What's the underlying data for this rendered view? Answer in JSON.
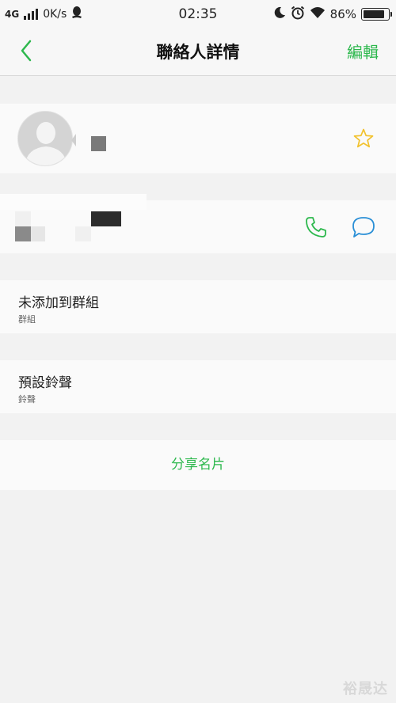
{
  "status_bar": {
    "network": "4G",
    "speed": "0K/s",
    "time": "02:35",
    "battery": "86%",
    "battery_level": 0.86,
    "icons": [
      "signal-icon",
      "qq-icon",
      "moon-icon",
      "alarm-icon",
      "wifi-icon",
      "battery-icon"
    ]
  },
  "nav": {
    "back_icon": "chevron-left-icon",
    "title": "聯絡人詳情",
    "edit_label": "編輯"
  },
  "contact": {
    "avatar_icon": "person-silhouette-icon",
    "favorite_icon": "star-icon"
  },
  "phone": {
    "call_icon": "phone-icon",
    "message_icon": "chat-bubble-icon"
  },
  "group": {
    "title": "未添加到群組",
    "subtitle": "群組"
  },
  "ringtone": {
    "title": "預設鈴聲",
    "subtitle": "鈴聲"
  },
  "share": {
    "label": "分享名片"
  },
  "colors": {
    "accent": "#2db84d",
    "star": "#f2c22e",
    "message": "#2a8fd6",
    "background": "#f2f2f2",
    "card": "#fafafa"
  },
  "watermark": "裕晟达"
}
